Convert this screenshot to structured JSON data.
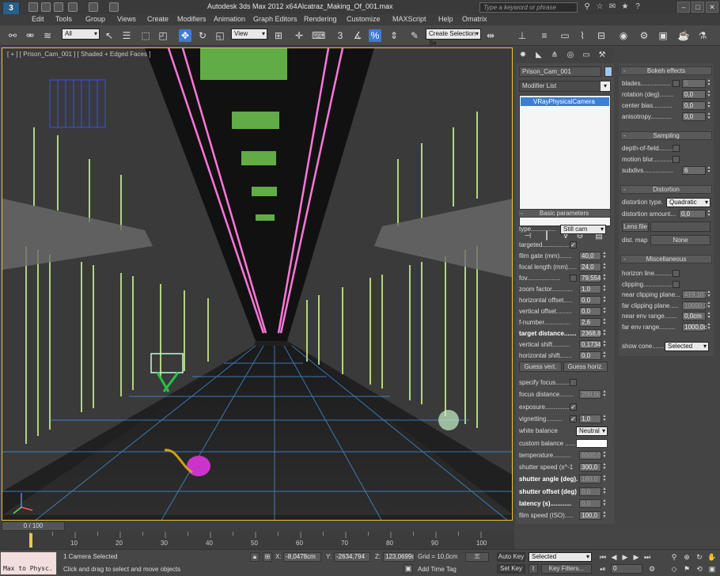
{
  "titlebar": {
    "app_title": "Autodesk 3ds Max  2012 x64",
    "file_name": "Alcatraz_Making_Of_001.max",
    "search_placeholder": "Type a keyword or phrase"
  },
  "menu": [
    "Edit",
    "Tools",
    "Group",
    "Views",
    "Create",
    "Modifiers",
    "Animation",
    "Graph Editors",
    "Rendering",
    "Customize",
    "MAXScript",
    "Help",
    "Omatrix"
  ],
  "toolbar": {
    "selection_filter": "All",
    "ref_coord": "View",
    "named_selection": "Create Selection Se"
  },
  "viewport": {
    "label": "[ + ] [ Prison_Cam_001 ] [ Shaded + Edged Faces ]"
  },
  "command_panel": {
    "object_name": "Prison_Cam_001",
    "modifier_list": "Modifier List",
    "stack_item": "VRayPhysicalCamera",
    "basic_params_title": "Basic parameters",
    "type_label": "type..............",
    "type_value": "Still cam",
    "props": [
      {
        "label": "targeted.................",
        "kind": "check",
        "checked": "✓"
      },
      {
        "label": "film gate (mm).......",
        "kind": "spin",
        "value": "40,0"
      },
      {
        "label": "focal length (mm).....",
        "kind": "spin",
        "value": "24,0"
      },
      {
        "label": "fov...................",
        "kind": "checkspin",
        "value": "79,554"
      },
      {
        "label": "zoom factor............",
        "kind": "spin",
        "value": "1,0"
      },
      {
        "label": "horizontal offset.....",
        "kind": "spin",
        "value": "0,0"
      },
      {
        "label": "vertical offset.........",
        "kind": "spin",
        "value": "0,0"
      },
      {
        "label": "f-number...............",
        "kind": "spin",
        "value": "2,6"
      },
      {
        "label": "target distance.......",
        "kind": "spin",
        "value": "2368,8",
        "bold": true
      },
      {
        "label": "vertical shift..........",
        "kind": "spin",
        "value": "0,1734"
      },
      {
        "label": "horizontal shift.......",
        "kind": "spin",
        "value": "0,0"
      }
    ],
    "guess_vert": "Guess vert.",
    "guess_horiz": "Guess horiz.",
    "props2": [
      {
        "label": "specify focus..........",
        "kind": "check",
        "checked": ""
      },
      {
        "label": "focus distance........",
        "kind": "spin",
        "value": "200,0c",
        "dim": true
      },
      {
        "label": "exposure.................",
        "kind": "check",
        "checked": "✓"
      },
      {
        "label": "vignetting.........",
        "kind": "checkspin",
        "value": "1,0",
        "checked": "✓"
      },
      {
        "label": "white balance",
        "kind": "dropdown",
        "value": "Neutral"
      },
      {
        "label": "custom balance ......",
        "kind": "swatch"
      },
      {
        "label": "temperature..........",
        "kind": "spin",
        "value": "6500,0",
        "dim": true
      },
      {
        "label": "shutter speed (s^-1",
        "kind": "spin",
        "value": "300,0"
      },
      {
        "label": "shutter angle (deg).",
        "kind": "spin",
        "value": "180,0",
        "bold": true,
        "dim": true
      },
      {
        "label": "shutter offset (deg)",
        "kind": "spin",
        "value": "0,0",
        "bold": true,
        "dim": true
      },
      {
        "label": "latency (s)............",
        "kind": "spin",
        "value": "0,0",
        "bold": true,
        "dim": true
      },
      {
        "label": "film speed (ISO).....",
        "kind": "spin",
        "value": "100,0"
      }
    ]
  },
  "vray_panel": {
    "bokeh_title": "Bokeh effects",
    "bokeh": [
      {
        "label": "blades.................",
        "kind": "checkspin",
        "value": "5",
        "dim": true
      },
      {
        "label": "rotation (deg)........",
        "kind": "spin",
        "value": "0,0"
      },
      {
        "label": "center bias...........",
        "kind": "spin",
        "value": "0,0"
      },
      {
        "label": "anisotropy............",
        "kind": "spin",
        "value": "0,0"
      }
    ],
    "sampling_title": "Sampling",
    "sampling": [
      {
        "label": "depth-of-field.........",
        "kind": "check",
        "checked": ""
      },
      {
        "label": "motion blur............",
        "kind": "check",
        "checked": ""
      },
      {
        "label": "subdivs.................",
        "kind": "spin",
        "value": "6"
      }
    ],
    "distortion_title": "Distortion",
    "distortion_type_label": "distortion type.",
    "distortion_type_value": "Quadratic",
    "distortion_amount_label": "distortion amount...",
    "distortion_amount_value": "0,0",
    "lens_file": "Lens file",
    "dist_map_label": "dist. map",
    "dist_map_value": "None",
    "misc_title": "Miscellaneous",
    "misc": [
      {
        "label": "horizon line............",
        "kind": "check",
        "checked": ""
      },
      {
        "label": "clipping..................",
        "kind": "check",
        "checked": ""
      },
      {
        "label": "near clipping plane...",
        "kind": "spin",
        "value": "419,107",
        "dim": true
      },
      {
        "label": "far clipping plane.....",
        "kind": "spin",
        "value": "10000,0",
        "dim": true
      },
      {
        "label": "near env range.......",
        "kind": "spin",
        "value": "0,0cm"
      },
      {
        "label": "far env range.........",
        "kind": "spin",
        "value": "1000,0c"
      }
    ],
    "show_cone_label": "show cone.........",
    "show_cone_value": "Selected"
  },
  "timeline": {
    "frame": "0 / 100",
    "ticks": [
      "10",
      "20",
      "30",
      "40",
      "50",
      "60",
      "70",
      "80",
      "90",
      "100"
    ]
  },
  "status": {
    "maxscript": "Max to Physc.",
    "selection": "1 Camera Selected",
    "prompt": "Click and drag to select and move objects",
    "x_label": "X:",
    "x_value": "-8,0478cm",
    "y_label": "Y:",
    "y_value": "-2634,794",
    "z_label": "Z:",
    "z_value": "123,0699c",
    "grid": "Grid = 10,0cm",
    "add_time_tag": "Add Time Tag",
    "auto_key": "Auto Key",
    "set_key": "Set Key",
    "key_mode": "Selected",
    "key_filters": "Key Filters...",
    "current_frame": "0"
  }
}
